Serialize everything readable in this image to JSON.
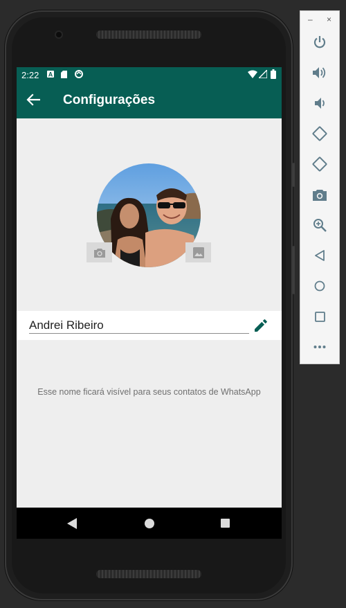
{
  "status_bar": {
    "time": "2:22",
    "icons": [
      "notification-a-icon",
      "sd-card-icon",
      "sync-icon",
      "wifi-icon",
      "signal-icon",
      "battery-icon"
    ]
  },
  "app_bar": {
    "back_icon": "arrow-left-icon",
    "title": "Configurações"
  },
  "profile": {
    "camera_button_icon": "camera-icon",
    "gallery_button_icon": "image-icon"
  },
  "name_field": {
    "value": "Andrei Ribeiro",
    "edit_icon": "pencil-icon"
  },
  "hint_text": "Esse nome ficará visível para seus contatos de WhatsApp",
  "nav_bar": {
    "buttons": [
      "back-triangle-icon",
      "home-circle-icon",
      "recents-square-icon"
    ]
  },
  "emulator_toolbar": {
    "window_controls": [
      "–",
      "×"
    ],
    "buttons": [
      "power-icon",
      "volume-up-icon",
      "volume-down-icon",
      "rotate-left-icon",
      "rotate-right-icon",
      "screenshot-icon",
      "zoom-icon",
      "back-icon",
      "home-icon",
      "overview-icon",
      "more-icon"
    ]
  },
  "colors": {
    "primary_dark": "#075e54",
    "accent": "#075e54",
    "screen_background": "#eeeeee"
  }
}
